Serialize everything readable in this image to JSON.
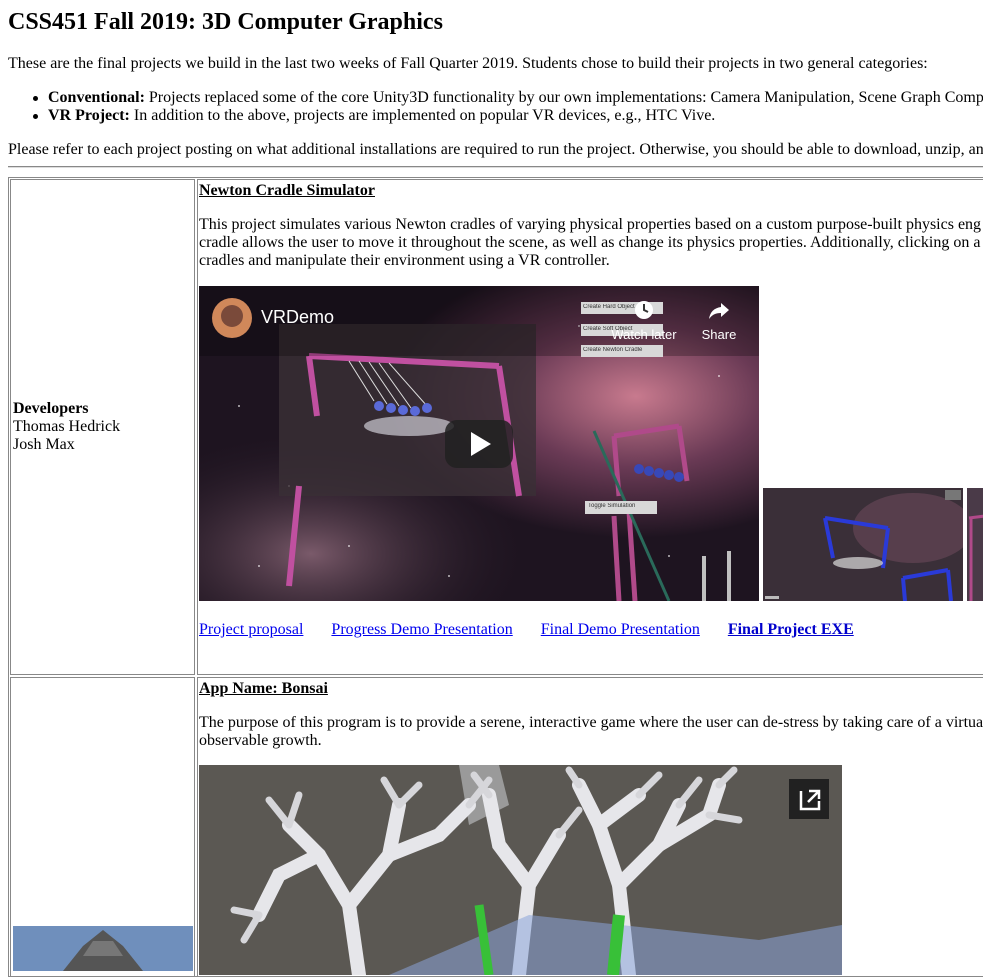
{
  "page": {
    "title": "CSS451 Fall 2019: 3D Computer Graphics",
    "intro": "These are the final projects we build in the last two weeks of Fall Quarter 2019. Students chose to build their projects in two general categories:",
    "categories": [
      {
        "label": "Conventional:",
        "text": " Projects replaced some of the core Unity3D functionality by our own implementations: Camera Manipulation, Scene Graph Comp"
      },
      {
        "label": "VR Project:",
        "text": " In addition to the above, projects are implemented on popular VR devices, e.g., HTC Vive."
      }
    ],
    "note": "Please refer to each project posting on what additional installations are required to run the project. Otherwise, you should be able to download, unzip, an"
  },
  "projects": [
    {
      "developers_label": "Developers",
      "developers": [
        "Thomas Hedrick",
        "Josh Max"
      ],
      "title": "Newton Cradle Simulator",
      "description": [
        "This project simulates various Newton cradles of varying physical properties based on a custom purpose-built physics eng",
        "cradle allows the user to move it throughout the scene, as well as change its physics properties. Additionally, clicking on a",
        "cradles and manipulate their environment using a VR controller."
      ],
      "video": {
        "channel": "VRDemo",
        "watch_later": "Watch later",
        "share": "Share",
        "buttons": [
          "Create Hard Object",
          "Create Soft Object",
          "Create Newton Cradle",
          "Toggle Simulation"
        ]
      },
      "links": [
        {
          "label": "Project proposal",
          "strong": false
        },
        {
          "label": "Progress Demo Presentation",
          "strong": false
        },
        {
          "label": "Final Demo Presentation",
          "strong": false
        },
        {
          "label": "Final Project EXE",
          "strong": true
        }
      ]
    },
    {
      "title": "App Name: Bonsai",
      "description": [
        "The purpose of this program is to provide a serene, interactive game where the user can de-stress by taking care of a virtua",
        "observable growth."
      ]
    }
  ],
  "colors": {
    "link": "#0000ee",
    "border": "#888888"
  }
}
